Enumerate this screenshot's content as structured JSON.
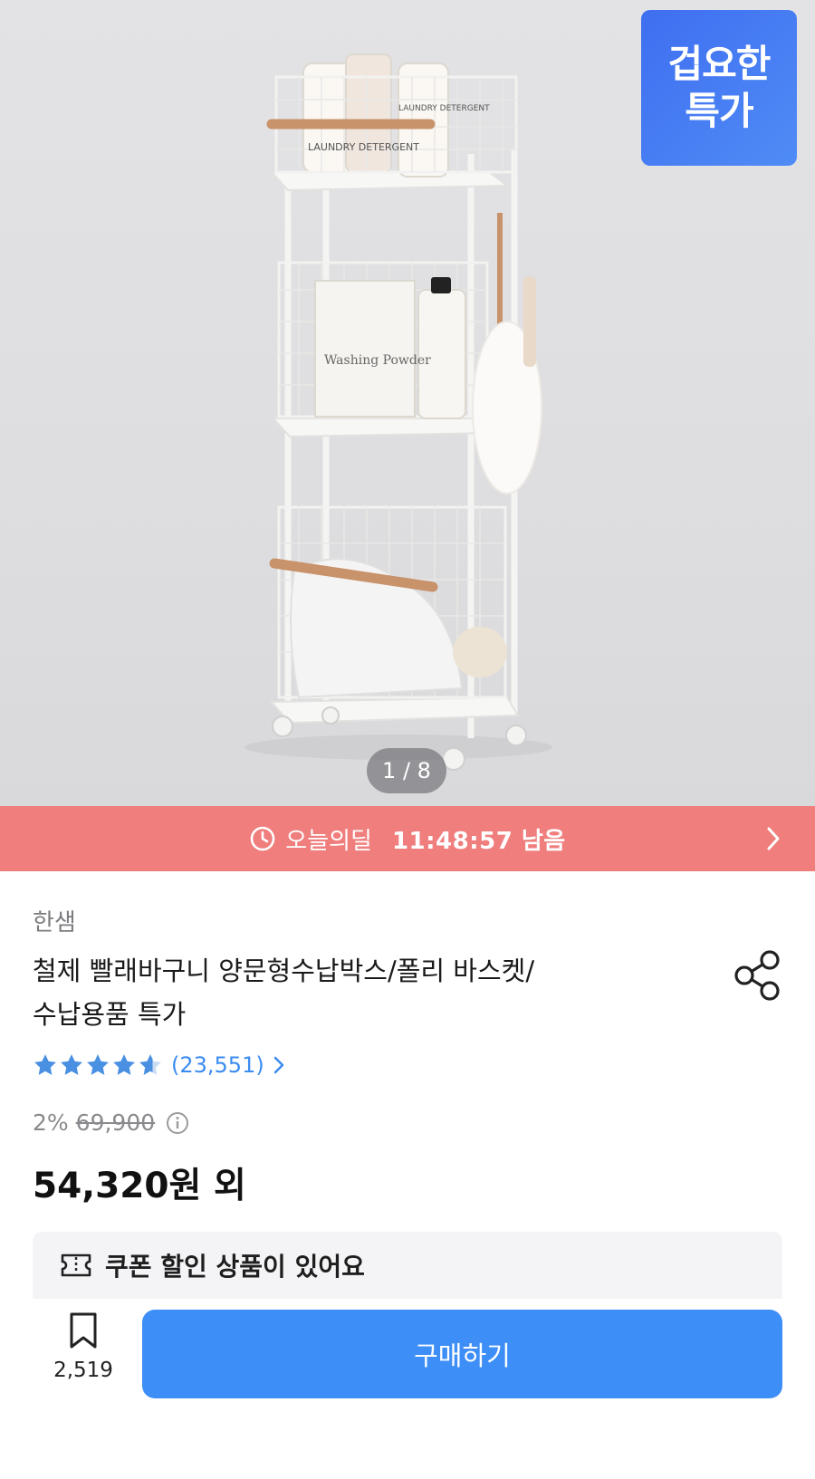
{
  "hero": {
    "badge_line1": "겁요한",
    "badge_line2": "특가",
    "pager": "1 / 8",
    "image_texts": [
      "LAUNDRY DETERGENT",
      "LAUNDRY DETERGENT",
      "Washing Powder"
    ]
  },
  "deal": {
    "label": "오늘의딜",
    "time_left": "11:48:57 남음"
  },
  "product": {
    "brand": "한샘",
    "title_line1": "철제 빨래바구니 양문형수납박스/폴리 바스켓/",
    "title_line2": "수납용품 특가",
    "rating": 4.5,
    "review_count": "(23,551)",
    "discount": "2%",
    "original_price": "69,900",
    "price": "54,320원 외"
  },
  "coupon": {
    "text": "쿠폰 할인 상품이 있어요"
  },
  "bottom_bar": {
    "wish_count": "2,519",
    "buy_label": "구매하기"
  },
  "colors": {
    "deal_bar": "#ef7e7d",
    "accent_blue": "#3d8ef7",
    "star": "#4a90e2",
    "badge": "#4f8cf6"
  }
}
